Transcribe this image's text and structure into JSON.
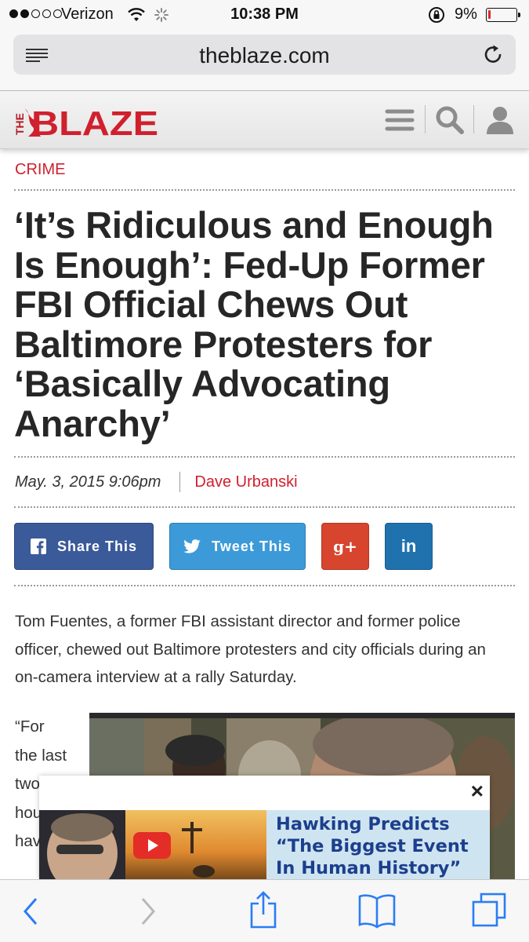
{
  "status_bar": {
    "carrier": "Verizon",
    "time": "10:38 PM",
    "battery_percent": "9%",
    "battery_level": 0.09,
    "signal_bars_filled": 2,
    "signal_bars_total": 5
  },
  "browser": {
    "url": "theblaze.com",
    "icons": [
      "reader-icon",
      "reload-icon"
    ]
  },
  "site_header": {
    "logo_the": "THE",
    "logo_blaze": "BLAZE",
    "icons": [
      "hamburger-menu-icon",
      "search-icon",
      "user-icon"
    ],
    "brand_color": "#d0202e"
  },
  "article": {
    "category": "CRIME",
    "headline": "‘It’s Ridiculous and Enough Is Enough’: Fed-Up Former FBI Official Chews Out Baltimore Protesters for ‘Basically Advocating Anarchy’",
    "date": "May. 3, 2015 9:06pm",
    "author": "Dave Urbanski",
    "share": {
      "facebook_label": "Share This",
      "twitter_label": "Tweet This",
      "googleplus_label": "g+",
      "linkedin_label": "in"
    },
    "intro": "Tom Fuentes, a former FBI assistant director and former police officer, chewed out Baltimore protesters and city officials during an on-camera interview at a rally Saturday.",
    "quote_lines": [
      "“For",
      "the last",
      "two",
      "hou",
      "hav"
    ]
  },
  "ad": {
    "close_label": "×",
    "headline": "Hawking Predicts “The Biggest Event In Human History”",
    "icons": [
      "close-icon",
      "play-icon"
    ]
  },
  "toolbar": {
    "icons": [
      "back-icon",
      "forward-icon",
      "share-icon",
      "bookmarks-icon",
      "tabs-icon"
    ]
  }
}
